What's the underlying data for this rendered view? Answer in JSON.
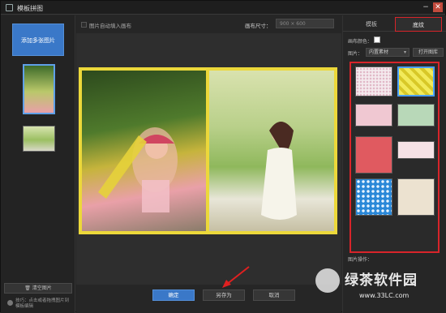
{
  "window": {
    "title": "模板拼图"
  },
  "left": {
    "add_label": "添加多张图片",
    "clear_label": "清空图片",
    "tip_text": "技巧：点击或者拖拽图片到模板编辑"
  },
  "topbar": {
    "auto_fill_label": "图片自动填入画布",
    "size_label": "画布尺寸：",
    "size_value": "900 × 600"
  },
  "right": {
    "tabs": [
      "模板",
      "底纹"
    ],
    "bg_color_label": "画布颜色：",
    "image_label": "图片：",
    "select_value": "内置素材",
    "open_lib_label": "打开图库",
    "ops_label": "图片操作："
  },
  "bottom": {
    "ok_label": "确定",
    "save_as_label": "另存为",
    "cancel_label": "取消"
  },
  "watermark": {
    "brand": "绿茶软件园",
    "url": "www.33LC.com"
  },
  "textures": [
    {
      "name": "pink-dots",
      "color": "#f2e6ea"
    },
    {
      "name": "yellow-stripes",
      "color": "#e8e04a"
    },
    {
      "name": "pink-light",
      "color": "#f0c8d2"
    },
    {
      "name": "green-light",
      "color": "#b8d8b8"
    },
    {
      "name": "red",
      "color": "#e05a60"
    },
    {
      "name": "pink-pale",
      "color": "#f6e2e6"
    },
    {
      "name": "blue-dots",
      "color": "#2a88d8"
    },
    {
      "name": "beige",
      "color": "#ece2d0"
    }
  ]
}
